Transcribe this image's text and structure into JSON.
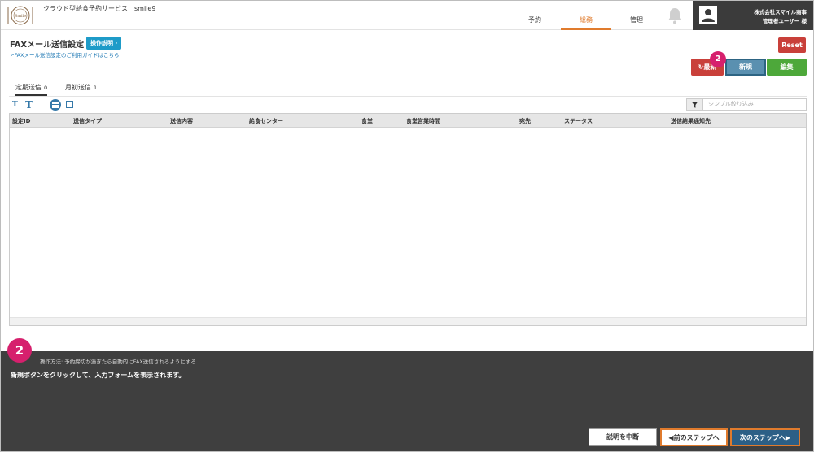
{
  "app": {
    "title": "クラウド型給食予約サービス　smile9",
    "logo_text": "Smile"
  },
  "nav": {
    "tabs": [
      {
        "label": "予約"
      },
      {
        "label": "総務"
      },
      {
        "label": "管理"
      }
    ],
    "active": "総務"
  },
  "user": {
    "company": "株式会社スマイル商事",
    "name": "管理者ユーザー 様"
  },
  "page": {
    "title": "FAXメール送信設定",
    "help_button": "操作説明 ›",
    "guide_link": "FAXメール送信設定のご利用ガイドはこちら",
    "reset_button": "Reset",
    "refresh_button": "最新",
    "new_button": "新規",
    "edit_button": "編集",
    "step_badge": "2"
  },
  "tabs": [
    {
      "label": "定期送信",
      "count": "0"
    },
    {
      "label": "月初送信",
      "count": "1"
    }
  ],
  "toolbar": {
    "font_small": "T",
    "font_large": "T",
    "filter_placeholder": "シンプル絞り込み"
  },
  "table": {
    "columns": [
      "設定ID",
      "送信タイプ",
      "送信内容",
      "給食センター",
      "食堂",
      "食堂営業時間",
      "宛先",
      "ステータス",
      "送信結果通知先"
    ]
  },
  "tutorial": {
    "step": "2",
    "operation": "操作方法: 予約締切が過ぎたら自動的にFAX送信されるようにする",
    "instruction": "新規ボタンをクリックして、入力フォームを表示されます。",
    "stop_button": "説明を中断",
    "prev_button": "◀前のステップへ",
    "next_button": "次のステップへ▶"
  },
  "colors": {
    "accent_orange": "#e07b2d",
    "help_blue": "#1e9bc8",
    "danger_red": "#c9403a",
    "new_blue": "#5a90b0",
    "edit_green": "#4da83a",
    "step_pink": "#d6206d",
    "user_bg": "#3b3b3b"
  }
}
